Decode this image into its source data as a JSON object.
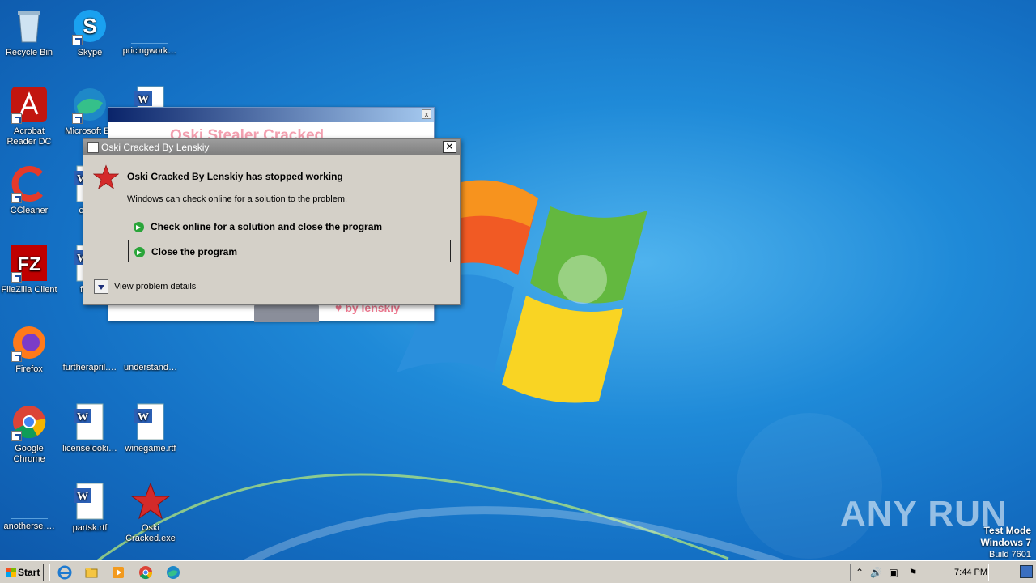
{
  "desktop": {
    "icons": [
      {
        "label": "Recycle Bin",
        "icon": "recycle-bin-icon"
      },
      {
        "label": "Skype",
        "icon": "skype-icon"
      },
      {
        "label": "pricingwork…",
        "icon": "blank-file-icon"
      },
      {
        "label": "Acrobat Reader DC",
        "icon": "acrobat-icon"
      },
      {
        "label": "Microsoft Ed",
        "icon": "edge-icon"
      },
      {
        "label": "",
        "icon": "word-doc-icon"
      },
      {
        "label": "CCleaner",
        "icon": "ccleaner-icon"
      },
      {
        "label": "confe",
        "icon": "word-doc-icon"
      },
      {
        "label": "FileZilla Client",
        "icon": "filezilla-icon"
      },
      {
        "label": "feedi",
        "icon": "word-doc-icon"
      },
      {
        "label": "Firefox",
        "icon": "firefox-icon"
      },
      {
        "label": "furtherapril.…",
        "icon": "blank-file-icon"
      },
      {
        "label": "understand…",
        "icon": "blank-file-icon"
      },
      {
        "label": "Google Chrome",
        "icon": "chrome-icon"
      },
      {
        "label": "licenselooki…",
        "icon": "word-doc-icon"
      },
      {
        "label": "winegame.rtf",
        "icon": "word-doc-icon"
      },
      {
        "label": "anotherse….",
        "icon": "blank-file-icon"
      },
      {
        "label": "partsk.rtf",
        "icon": "word-doc-icon"
      },
      {
        "label": "Oski Cracked.exe",
        "icon": "red-star-icon"
      }
    ]
  },
  "background_window": {
    "title": "Oski Stealer Cracked",
    "byline": "by lenskiy"
  },
  "dialog": {
    "title": "Oski Cracked By Lenskiy",
    "heading": "Oski Cracked By Lenskiy has stopped working",
    "message": "Windows can check online for a solution to the problem.",
    "option_check": "Check online for a solution and close the program",
    "option_close": "Close the program",
    "details": "View problem details",
    "close_glyph": "✕"
  },
  "watermark": {
    "text": "ANY RUN",
    "mode_line1": "Test Mode",
    "mode_line2": "Windows 7",
    "mode_line3": "Build 7601"
  },
  "taskbar": {
    "start_label": "Start",
    "clock": "7:44 PM"
  }
}
